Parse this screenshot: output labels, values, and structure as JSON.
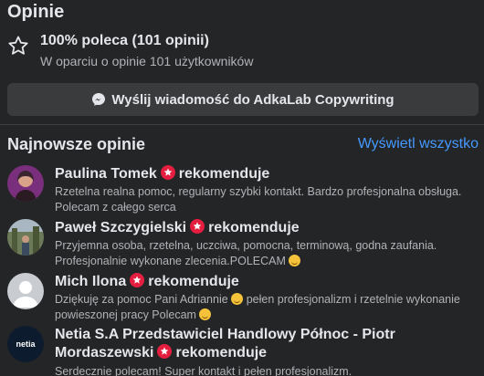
{
  "header": {
    "title": "Opinie",
    "rating_headline": "100% poleca (101 opinii)",
    "rating_sub": "W oparciu o opinie 101 użytkowników"
  },
  "message_button": {
    "label": "Wyślij wiadomość do AdkaLab Copywriting"
  },
  "recent": {
    "title": "Najnowsze opinie",
    "see_all": "Wyświetl wszystko",
    "recommends": "rekomenduje",
    "reviews": [
      {
        "name": "Paulina Tomek",
        "text": "Rzetelna realna pomoc, regularny szybki kontakt. Bardzo profesjonalna obsługa. Polecam z całego serca"
      },
      {
        "name": "Paweł Szczygielski",
        "text": "Przyjemna osoba, rzetelna, uczciwa, pomocna, terminową, godna zaufania. Profesjonalnie wykonane zlecenia.POLECAM"
      },
      {
        "name": "Mich Ilona",
        "text_a": "Dziękuję za pomoc Pani Adriannie",
        "text_b": "pełen profesjonalizm i rzetelnie wykonanie powieszonej pracy Polecam"
      },
      {
        "name": "Netia S.A Przedstawiciel Handlowy Północ - Piotr Mordaszewski",
        "text": "Serdecznie polecam! Super kontakt i pełen profesjonalizm.",
        "avatar_text": "netia"
      }
    ]
  },
  "colors": {
    "background": "#242526",
    "link": "#4599ff",
    "badge": "#e41e3f"
  }
}
